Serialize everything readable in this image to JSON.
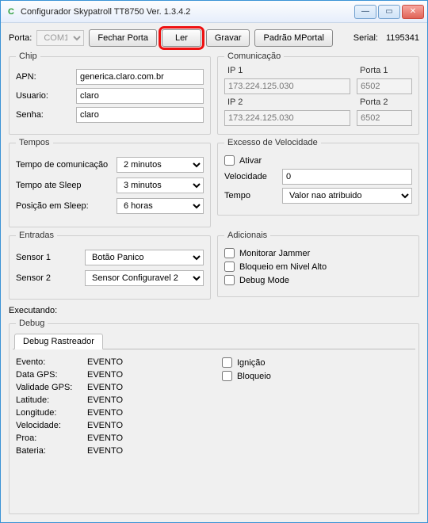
{
  "window": {
    "title": "Configurador Skypatroll TT8750 Ver. 1.3.4.2",
    "icon_glyph": "C"
  },
  "top": {
    "porta_label": "Porta:",
    "porta_value": "COM1",
    "btn_fechar": "Fechar Porta",
    "btn_ler": "Ler",
    "btn_gravar": "Gravar",
    "btn_padrao": "Padrão MPortal",
    "serial_label": "Serial:",
    "serial_value": "1195341"
  },
  "chip": {
    "legend": "Chip",
    "apn_label": "APN:",
    "apn_value": "generica.claro.com.br",
    "usuario_label": "Usuario:",
    "usuario_value": "claro",
    "senha_label": "Senha:",
    "senha_value": "claro"
  },
  "comunicacao": {
    "legend": "Comunicação",
    "ip1_label": "IP 1",
    "porta1_label": "Porta 1",
    "ip1_value": "173.224.125.030",
    "porta1_value": "6502",
    "ip2_label": "IP 2",
    "porta2_label": "Porta 2",
    "ip2_value": "173.224.125.030",
    "porta2_value": "6502"
  },
  "tempos": {
    "legend": "Tempos",
    "comunicacao_label": "Tempo de comunicação",
    "comunicacao_value": "2 minutos",
    "sleep_label": "Tempo ate Sleep",
    "sleep_value": "3 minutos",
    "posicao_label": "Posição em Sleep:",
    "posicao_value": "6 horas"
  },
  "velocidade": {
    "legend": "Excesso de Velocidade",
    "ativar_label": "Ativar",
    "velocidade_label": "Velocidade",
    "velocidade_value": "0",
    "tempo_label": "Tempo",
    "tempo_value": "Valor nao atribuido"
  },
  "entradas": {
    "legend": "Entradas",
    "sensor1_label": "Sensor 1",
    "sensor1_value": "Botão Panico",
    "sensor2_label": "Sensor 2",
    "sensor2_value": "Sensor Configuravel 2"
  },
  "adicionais": {
    "legend": "Adicionais",
    "jammer_label": "Monitorar Jammer",
    "bloqueio_label": "Bloqueio em Nivel Alto",
    "debug_label": "Debug Mode"
  },
  "exec_label": "Executando:",
  "debug": {
    "legend": "Debug",
    "tab": "Debug Rastreador",
    "rows": {
      "evento_k": "Evento:",
      "evento_v": "EVENTO",
      "datagps_k": "Data GPS:",
      "datagps_v": "EVENTO",
      "validade_k": "Validade GPS:",
      "validade_v": "EVENTO",
      "latitude_k": "Latitude:",
      "latitude_v": "EVENTO",
      "longitude_k": "Longitude:",
      "longitude_v": "EVENTO",
      "velocidade_k": "Velocidade:",
      "velocidade_v": "EVENTO",
      "proa_k": "Proa:",
      "proa_v": "EVENTO",
      "bateria_k": "Bateria:",
      "bateria_v": "EVENTO"
    },
    "ignicao_label": "Ignição",
    "bloqueio_label": "Bloqueio"
  }
}
